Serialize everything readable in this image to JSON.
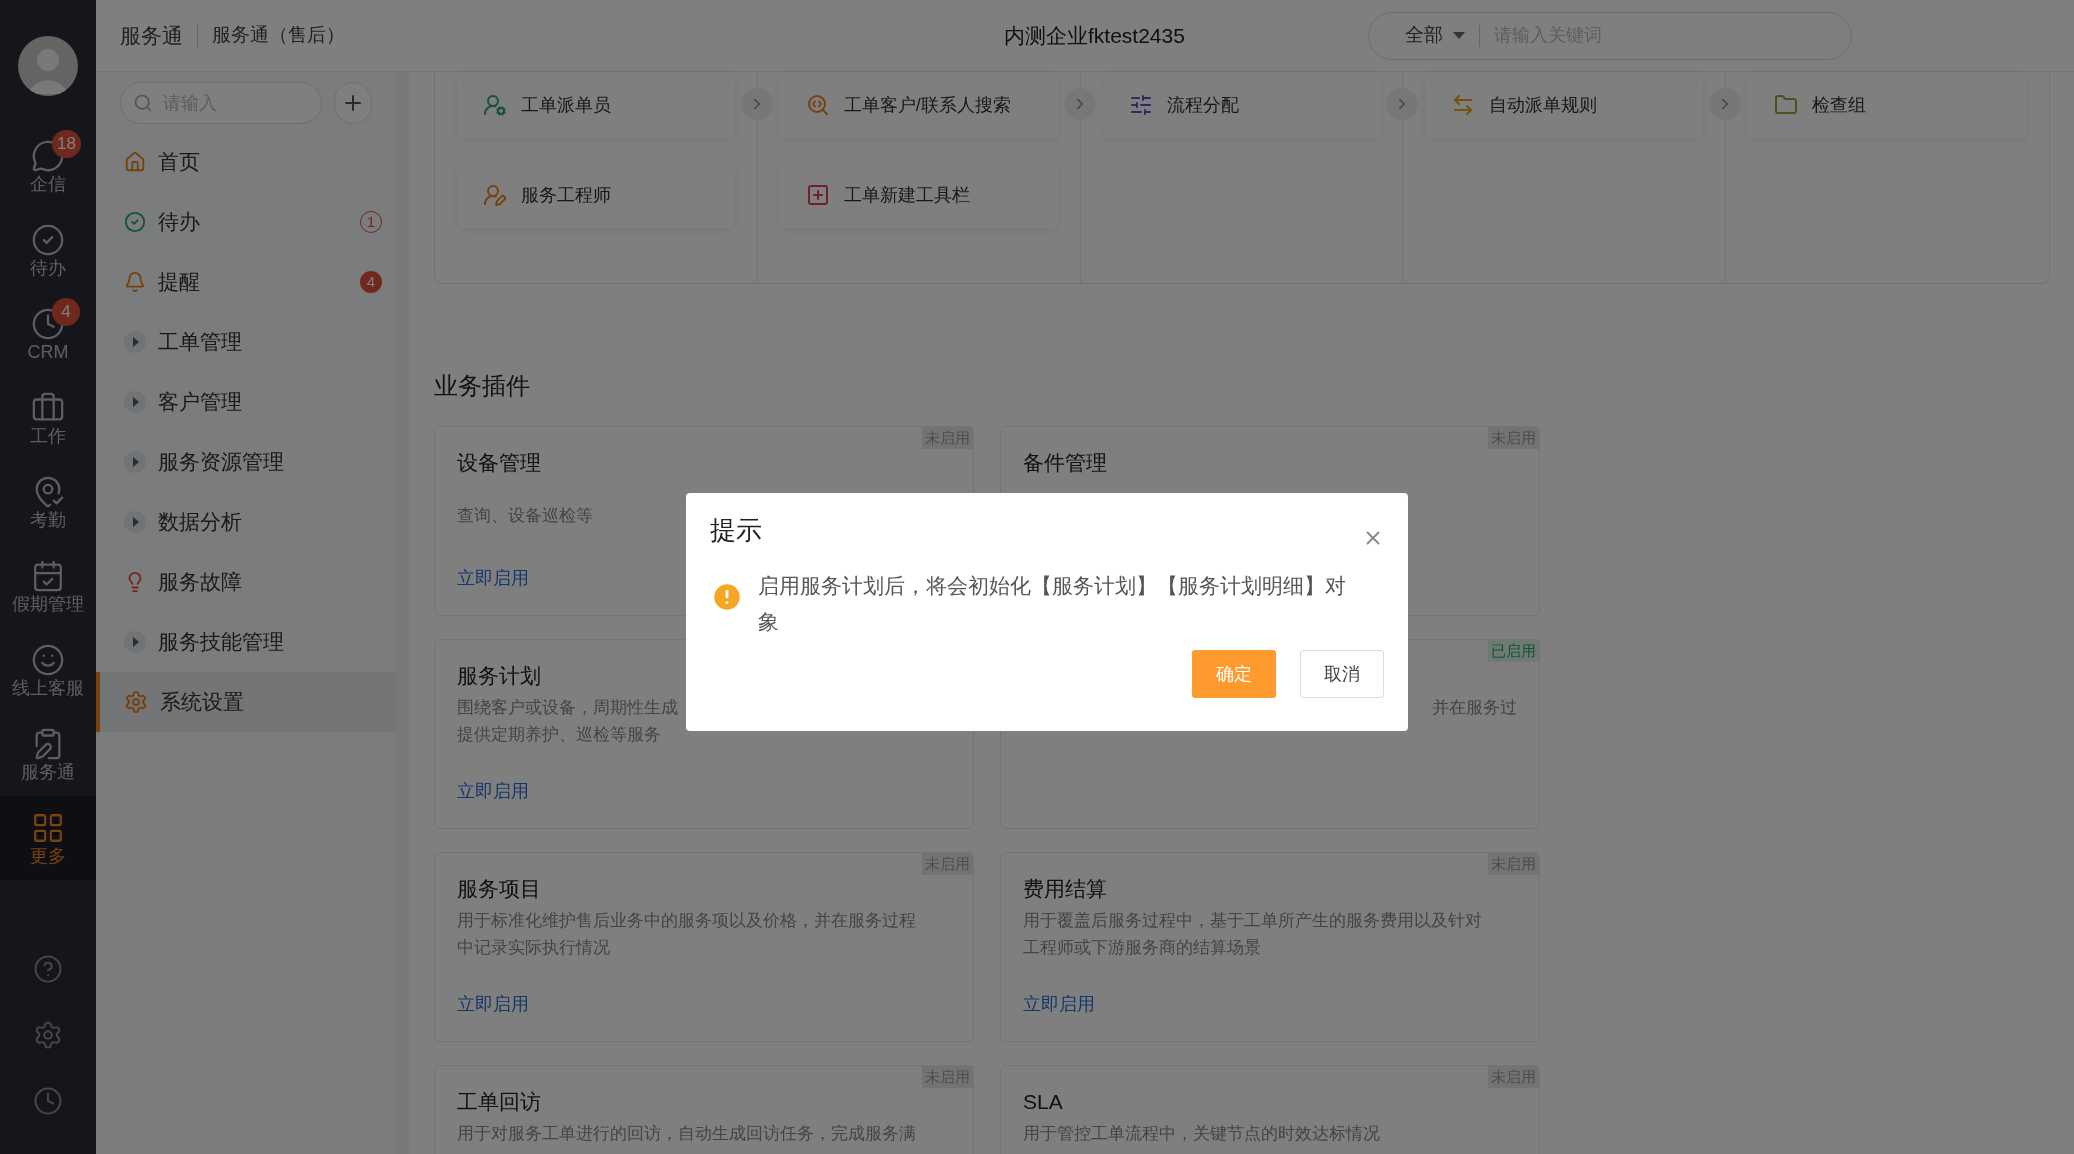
{
  "rail": {
    "items": [
      {
        "label": "企信",
        "kind": "chat",
        "badge": "18",
        "selected": false
      },
      {
        "label": "待办",
        "kind": "check",
        "selected": false
      },
      {
        "label": "CRM",
        "kind": "clock",
        "badge": "4",
        "selected": false
      },
      {
        "label": "工作",
        "kind": "briefcase",
        "selected": false
      },
      {
        "label": "考勤",
        "kind": "pin",
        "selected": false
      },
      {
        "label": "假期管理",
        "kind": "calendar",
        "selected": false
      },
      {
        "label": "线上客服",
        "kind": "smile",
        "selected": false
      },
      {
        "label": "服务通",
        "kind": "clipboard",
        "selected": false
      },
      {
        "label": "更多",
        "kind": "grid",
        "selected": true
      }
    ]
  },
  "header": {
    "app": "服务通",
    "section": "服务通（售后）",
    "company": "内测企业fktest2435",
    "scope": "全部",
    "search_placeholder": "请输入关键词"
  },
  "sidebar": {
    "search_placeholder": "请输入",
    "items": [
      {
        "label": "首页",
        "kind": "home",
        "selected": false
      },
      {
        "label": "待办",
        "kind": "todo",
        "badge": {
          "text": "1",
          "kind": "outline"
        },
        "selected": false
      },
      {
        "label": "提醒",
        "kind": "bell",
        "badge": {
          "text": "4",
          "kind": "solid"
        },
        "selected": false
      },
      {
        "label": "工单管理",
        "kind": "group",
        "selected": false
      },
      {
        "label": "客户管理",
        "kind": "group",
        "selected": false
      },
      {
        "label": "服务资源管理",
        "kind": "group",
        "selected": false
      },
      {
        "label": "数据分析",
        "kind": "group",
        "selected": false
      },
      {
        "label": "服务故障",
        "kind": "bulb",
        "selected": false
      },
      {
        "label": "服务技能管理",
        "kind": "group",
        "selected": false
      },
      {
        "label": "系统设置",
        "kind": "gear",
        "selected": true
      }
    ]
  },
  "tools": [
    {
      "label": "工单派单员",
      "kind": "dispatcher"
    },
    {
      "label": "工单客户/联系人搜索",
      "kind": "search"
    },
    {
      "label": "流程分配",
      "kind": "sliders"
    },
    {
      "label": "自动派单规则",
      "kind": "rule"
    },
    {
      "label": "检查组",
      "kind": "folder"
    },
    {
      "label": "服务工程师",
      "kind": "engineer"
    },
    {
      "label": "工单新建工具栏",
      "kind": "toolbar"
    }
  ],
  "plugins": {
    "title": "业务插件",
    "cards": [
      {
        "title": "设备管理",
        "kind": "lowered",
        "status": "未启用",
        "enabled": false,
        "lines": [
          "查询、设备巡检等"
        ],
        "link": "立即启用"
      },
      {
        "title": "备件管理",
        "kind": "normal",
        "status": "未启用",
        "enabled": false
      },
      {
        "title": "服务计划",
        "lines": [
          "围绕客户或设备，周期性生成",
          "提供定期养护、巡检等服务"
        ],
        "link": "立即启用"
      },
      {
        "status": "已启用",
        "enabled": true,
        "lines": [
          "并在服务过"
        ]
      },
      {
        "title": "服务项目",
        "status": "未启用",
        "enabled": false,
        "lines": [
          "用于标准化维护售后业务中的服务项以及价格，并在服务过程",
          "中记录实际执行情况"
        ],
        "link": "立即启用"
      },
      {
        "title": "费用结算",
        "status": "未启用",
        "enabled": false,
        "lines": [
          "用于覆盖后服务过程中，基于工单所产生的服务费用以及针对",
          "工程师或下游服务商的结算场景"
        ],
        "link": "立即启用"
      },
      {
        "title": "工单回访",
        "status": "未启用",
        "enabled": false,
        "lines": [
          "用于对服务工单进行的回访，自动生成回访任务，完成服务满"
        ]
      },
      {
        "title": "SLA",
        "status": "未启用",
        "enabled": false,
        "lines": [
          "用于管控工单流程中，关键节点的时效达标情况"
        ]
      }
    ]
  },
  "dialog": {
    "title": "提示",
    "message": "启用服务计划后，将会初始化【服务计划】【服务计划明细】对象",
    "buttons": [
      {
        "label": "确定",
        "kind": "primary"
      },
      {
        "label": "取消",
        "kind": "secondary"
      }
    ]
  }
}
